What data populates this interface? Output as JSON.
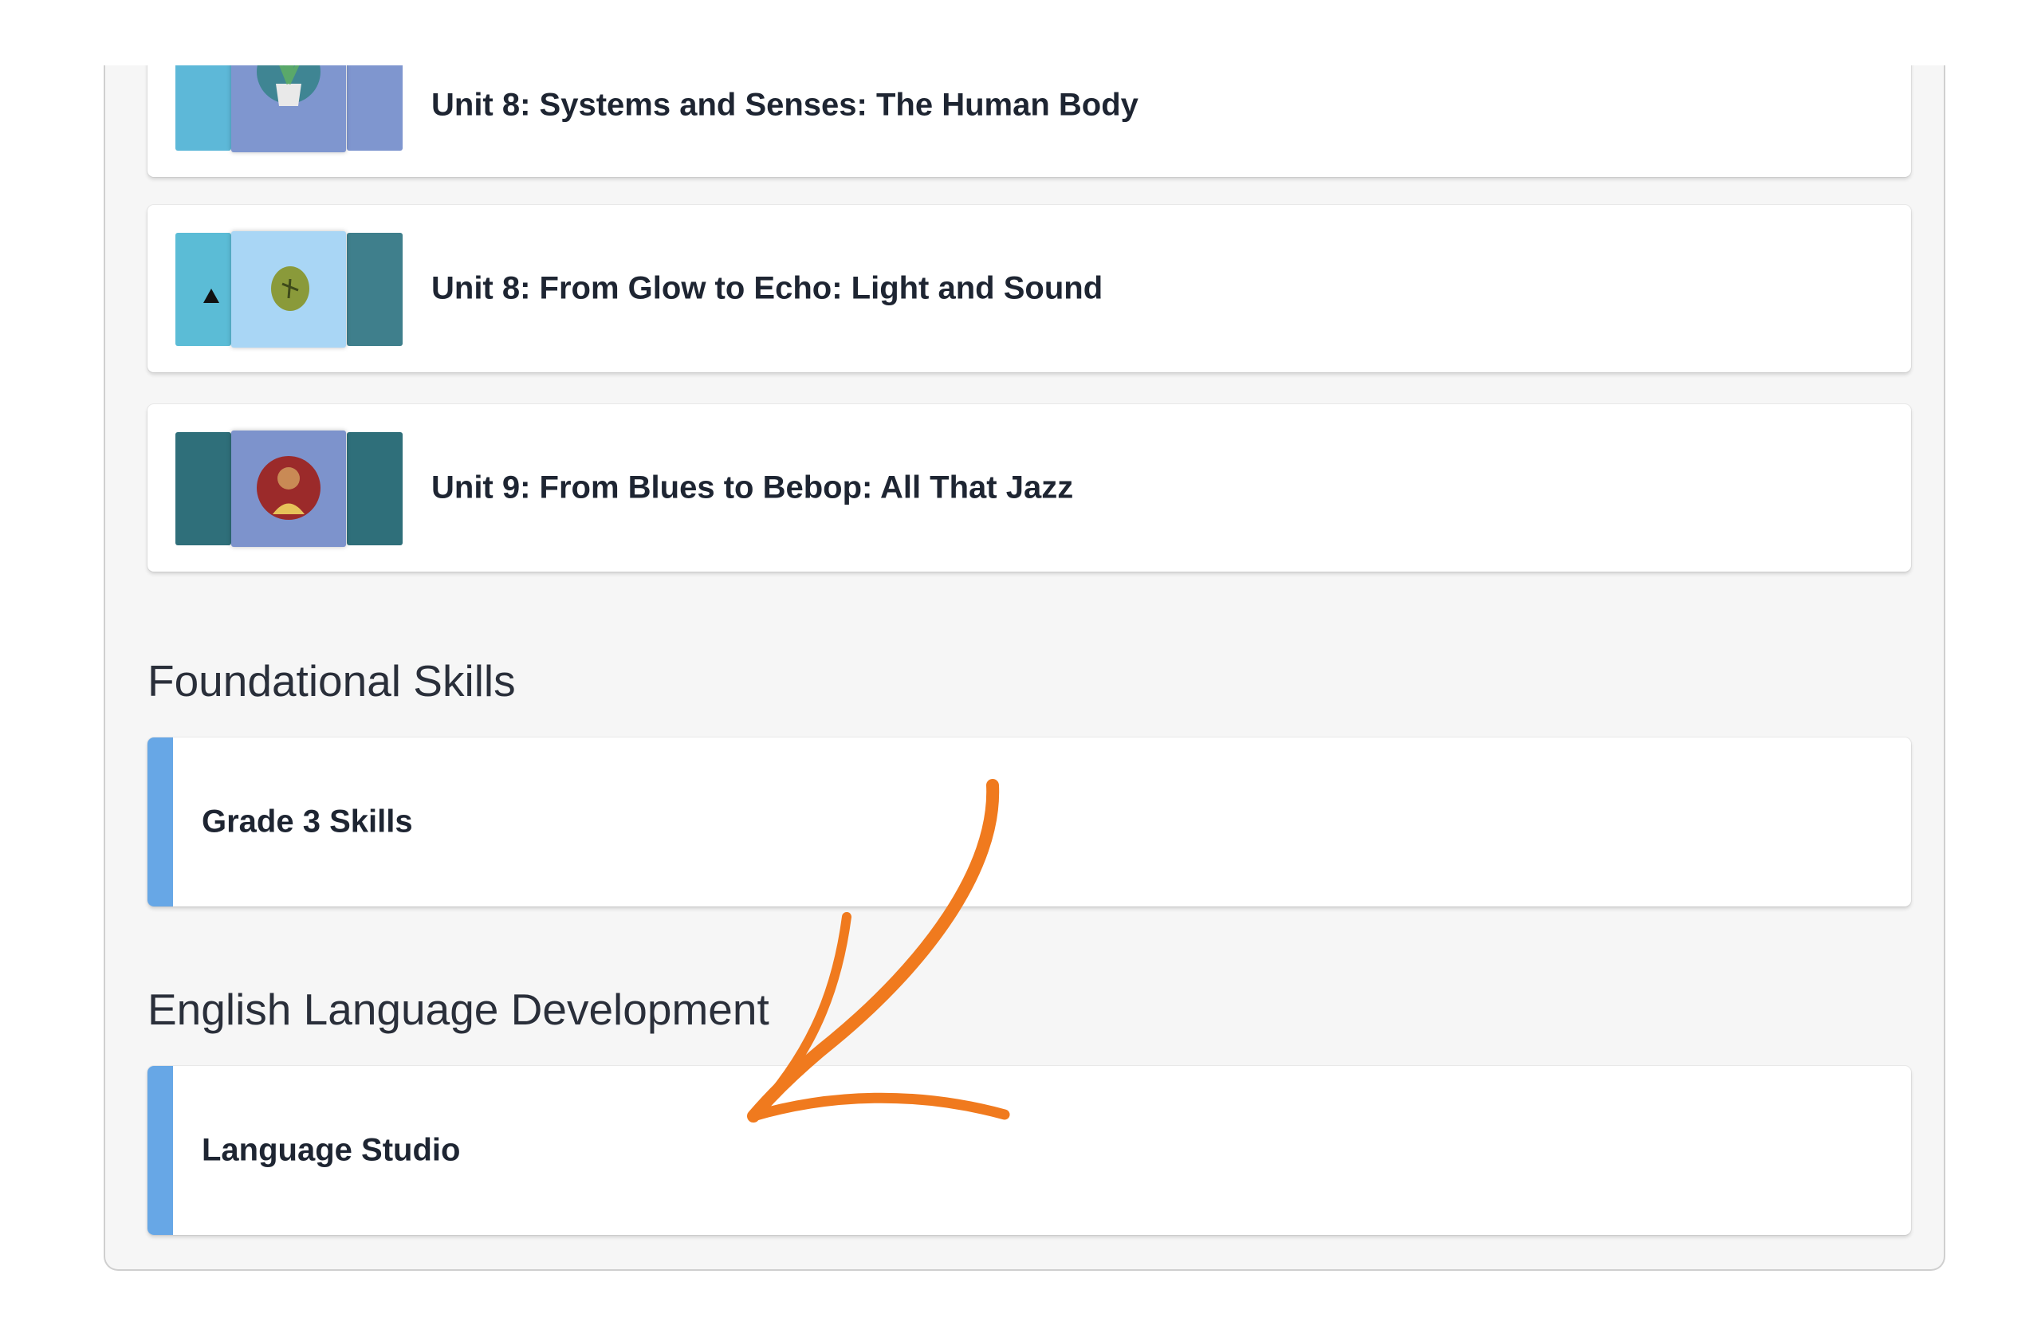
{
  "colors": {
    "accent": "#67a7e6",
    "arrow": "#f07a1e",
    "text": "#1e2532",
    "panel_bg": "#f6f6f6"
  },
  "units": [
    {
      "title": "Unit 8: Systems and Senses: The Human Body",
      "thumb_colors": [
        "#5db8d8",
        "#7f96cf",
        "#7f96cf"
      ],
      "icon": "plant-icon"
    },
    {
      "title": "Unit 8: From Glow to Echo: Light and Sound",
      "thumb_colors": [
        "#5bbcd6",
        "#a9d6f5",
        "#3f7f8c"
      ],
      "icon": "seed-icon"
    },
    {
      "title": "Unit 9: From Blues to Bebop: All That Jazz",
      "thumb_colors": [
        "#2f6f7a",
        "#7d93cc",
        "#2f6f7a"
      ],
      "icon": "singer-icon"
    }
  ],
  "sections": {
    "foundational": {
      "heading": "Foundational Skills",
      "items": [
        {
          "title": "Grade 3 Skills"
        }
      ]
    },
    "eld": {
      "heading": "English Language Development",
      "items": [
        {
          "title": "Language Studio"
        }
      ]
    }
  }
}
